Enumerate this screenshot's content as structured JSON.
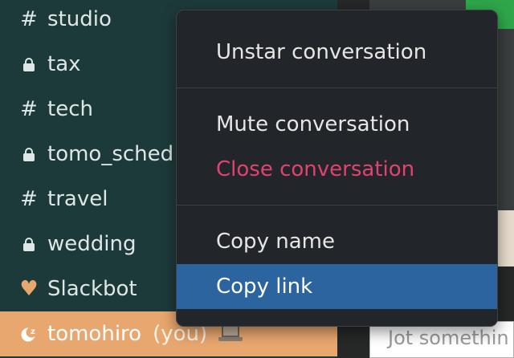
{
  "sidebar": {
    "channels": [
      {
        "icon": "#",
        "label": "studio"
      },
      {
        "icon": "lock",
        "label": "tax"
      },
      {
        "icon": "#",
        "label": "tech"
      },
      {
        "icon": "lock",
        "label": "tomo_sched"
      },
      {
        "icon": "#",
        "label": "travel"
      },
      {
        "icon": "lock",
        "label": "wedding"
      },
      {
        "icon": "heart",
        "label": "Slackbot"
      }
    ],
    "active_user": {
      "label": "tomohiro",
      "suffix": "(you)",
      "status_icon": "laptop"
    }
  },
  "menu": {
    "items": [
      {
        "label": "Unstar conversation"
      },
      {
        "label": "Mute conversation"
      },
      {
        "label": "Close conversation"
      },
      {
        "label": "Copy name"
      },
      {
        "label": "Copy link"
      }
    ]
  },
  "composer": {
    "placeholder": "Jot somethin"
  },
  "colors": {
    "sidebar_bg": "#1d3a3a",
    "active_bg": "#e8a76f",
    "menu_bg": "#222529",
    "highlight": "#2c64a0",
    "danger": "#e0436f"
  }
}
